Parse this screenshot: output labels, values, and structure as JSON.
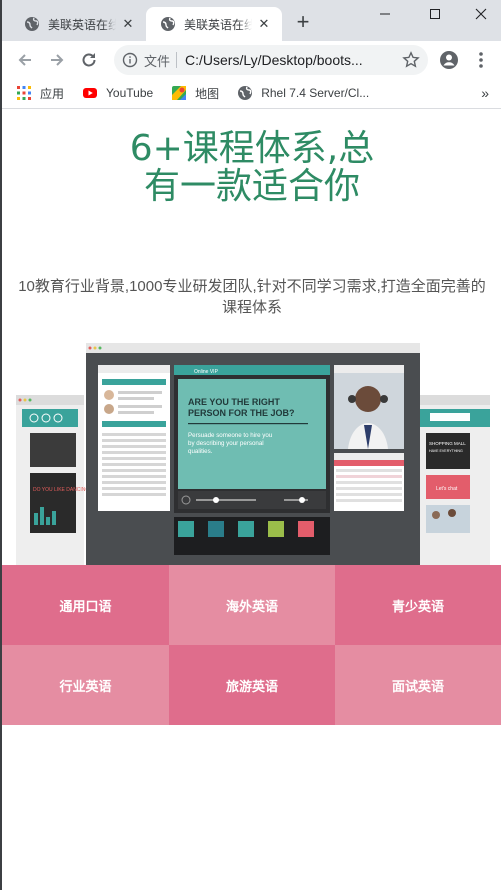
{
  "browser": {
    "tabs": [
      {
        "title": "美联英语在线",
        "active": false
      },
      {
        "title": "美联英语在线",
        "active": true
      }
    ],
    "new_tab_label": "+",
    "window_controls": {
      "minimize": "—",
      "maximize": "☐",
      "close": "✕"
    },
    "address_bar": {
      "scheme_label": "文件",
      "url": "C:/Users/Ly/Desktop/boots..."
    },
    "bookmarks": [
      {
        "label": "应用",
        "icon": "apps-grid-icon"
      },
      {
        "label": "YouTube",
        "icon": "youtube-icon"
      },
      {
        "label": "地图",
        "icon": "maps-icon"
      },
      {
        "label": "Rhel 7.4 Server/Cl...",
        "icon": "globe-icon"
      }
    ],
    "bookmarks_overflow": "»"
  },
  "page": {
    "title": "6+课程体系,总有一款适合你",
    "subtitle": "10教育行业背景,1000专业研发团队,针对不同学习需求,打造全面完善的课程体系",
    "showcase": {
      "heading": "ARE YOU THE RIGHT PERSON FOR THE JOB?",
      "body": "Persuade someone to hire you by describing your personal qualities.",
      "brand": "Online VIP",
      "left_promo": "DO YOU LIKE DANCING?",
      "right_promo_top": "SHOPPING MALL",
      "right_promo_sub": "HAVE EVERYTHING",
      "right_chat": "Let's chat"
    },
    "courses": [
      {
        "label": "通用口语",
        "tone": "dark"
      },
      {
        "label": "海外英语",
        "tone": "light"
      },
      {
        "label": "青少英语",
        "tone": "dark"
      },
      {
        "label": "行业英语",
        "tone": "light"
      },
      {
        "label": "旅游英语",
        "tone": "dark"
      },
      {
        "label": "面试英语",
        "tone": "light"
      }
    ]
  },
  "colors": {
    "title_green": "#2e8b64",
    "tile_dark": "#df6d8c",
    "tile_light": "#e58da2",
    "teal": "#3aa39b"
  }
}
